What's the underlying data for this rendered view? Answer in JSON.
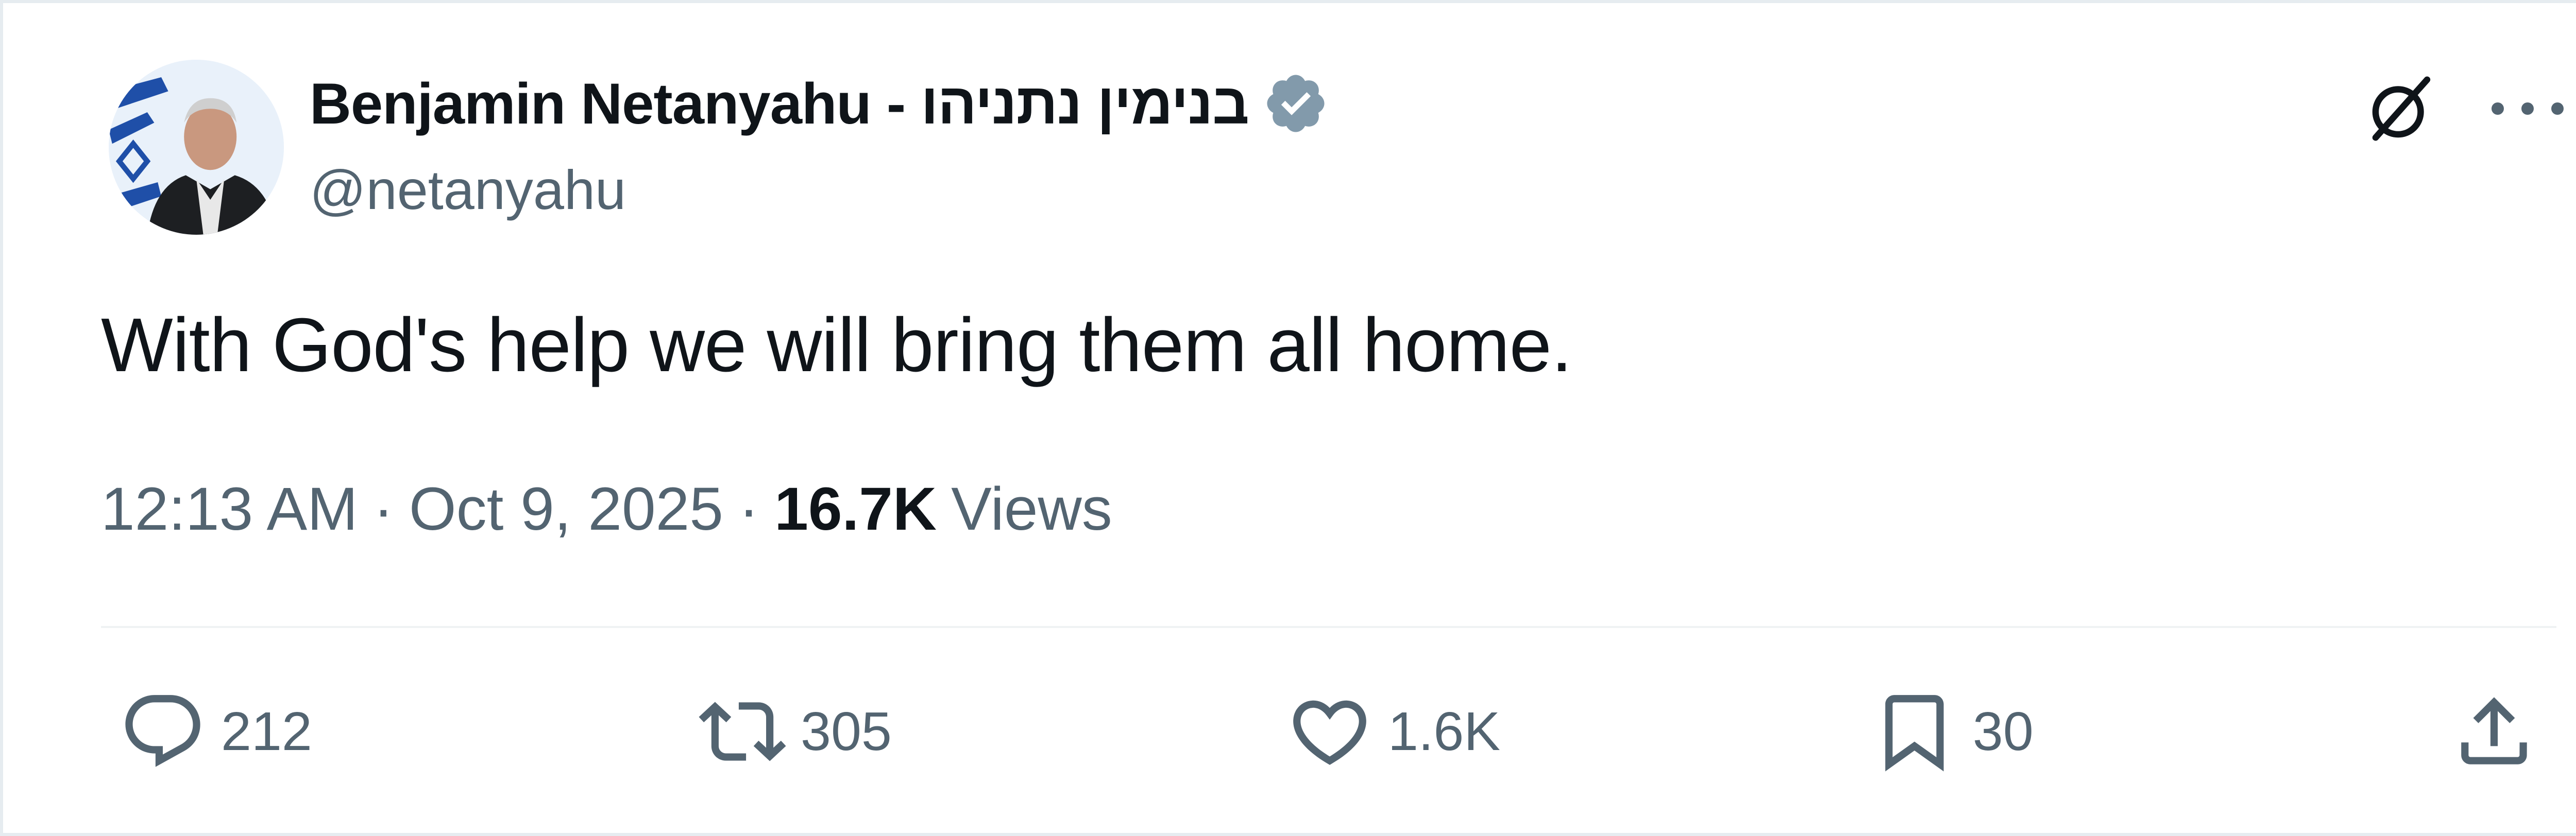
{
  "author": {
    "name": "Benjamin Netanyahu - בנימין נתניהו",
    "handle": "@netanyahu",
    "verified": true
  },
  "tweet": {
    "text": "With God's help we will bring them all home.",
    "time": "12:13 AM",
    "date": "Oct 9, 2025",
    "views_count": "16.7K",
    "views_label": "Views"
  },
  "actions": {
    "replies": "212",
    "retweets": "305",
    "likes": "1.6K",
    "bookmarks": "30"
  },
  "icons": {
    "verified": "verified-badge-icon",
    "grok": "grok-icon",
    "more": "more-icon",
    "reply": "reply-icon",
    "retweet": "retweet-icon",
    "like": "heart-icon",
    "bookmark": "bookmark-icon",
    "share": "share-icon"
  },
  "colors": {
    "text": "#0f1419",
    "secondary": "#536471",
    "verified_badge": "#829aab",
    "divider": "#eff3f4"
  }
}
